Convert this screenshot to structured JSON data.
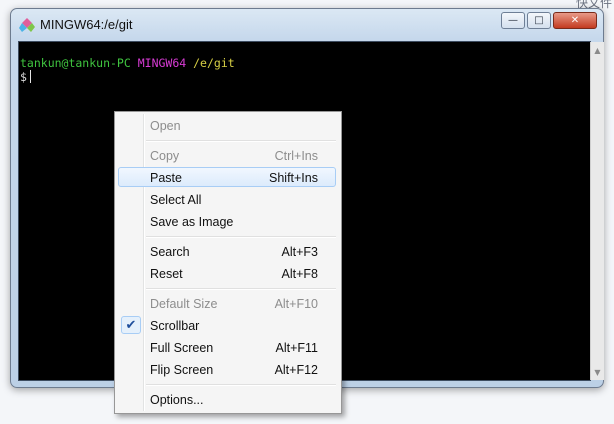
{
  "desktop": {
    "corner_text": "快文件"
  },
  "window": {
    "title": "MINGW64:/e/git",
    "buttons": {
      "minimize": "—",
      "maximize": "□",
      "close": "✕"
    }
  },
  "terminal": {
    "prompt": {
      "user": "tankun@tankun-PC",
      "system": "MINGW64",
      "path": "/e/git",
      "symbol": "$"
    }
  },
  "scrollbar": {
    "up_arrow": "▲",
    "down_arrow": "▼"
  },
  "context_menu": {
    "items": [
      {
        "label": "Open",
        "shortcut": ""
      },
      {
        "label": "Copy",
        "shortcut": "Ctrl+Ins"
      },
      {
        "label": "Paste",
        "shortcut": "Shift+Ins"
      },
      {
        "label": "Select All",
        "shortcut": ""
      },
      {
        "label": "Save as Image",
        "shortcut": ""
      },
      {
        "label": "Search",
        "shortcut": "Alt+F3"
      },
      {
        "label": "Reset",
        "shortcut": "Alt+F8"
      },
      {
        "label": "Default Size",
        "shortcut": "Alt+F10"
      },
      {
        "label": "Scrollbar",
        "shortcut": "",
        "check": "✔"
      },
      {
        "label": "Full Screen",
        "shortcut": "Alt+F11"
      },
      {
        "label": "Flip Screen",
        "shortcut": "Alt+F12"
      },
      {
        "label": "Options...",
        "shortcut": ""
      }
    ]
  },
  "colors": {
    "terminal_bg": "#000000",
    "prompt_user": "#3fc43f",
    "prompt_system": "#d93bd6",
    "prompt_path": "#d7cf45",
    "highlight": "#dcebfc"
  }
}
